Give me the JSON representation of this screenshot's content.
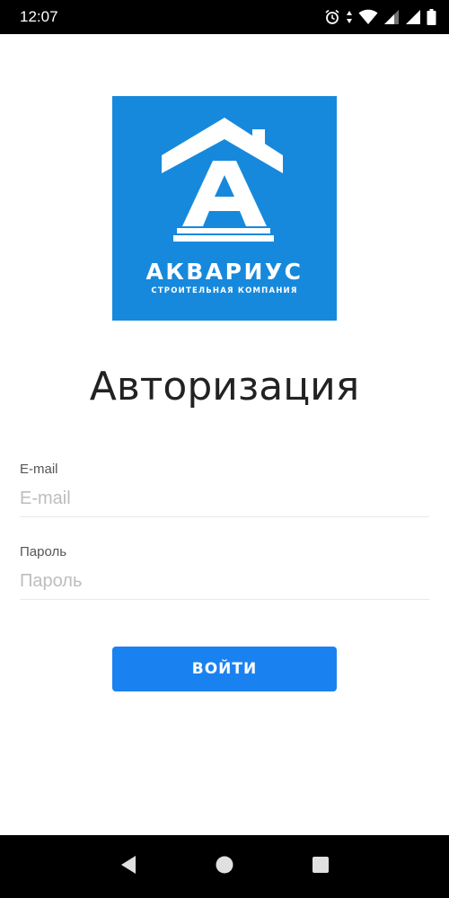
{
  "status_bar": {
    "time": "12:07",
    "icons": [
      "alarm-icon",
      "data-arrows-icon",
      "wifi-icon",
      "signal-icon",
      "signal-icon",
      "battery-icon"
    ]
  },
  "logo": {
    "brand": "АКВАРИУС",
    "tagline": "СТРОИТЕЛЬНАЯ КОМПАНИЯ",
    "background": "#1689dc"
  },
  "page": {
    "title": "Авторизация"
  },
  "form": {
    "email": {
      "label": "E-mail",
      "placeholder": "E-mail",
      "value": ""
    },
    "password": {
      "label": "Пароль",
      "placeholder": "Пароль",
      "value": ""
    },
    "submit_label": "ВОЙТИ"
  },
  "colors": {
    "accent": "#1a82f0",
    "logo_bg": "#1689dc",
    "text": "#222222",
    "placeholder": "#bdbdbd"
  },
  "nav_bar": {
    "buttons": [
      "back-icon",
      "home-icon",
      "recents-icon"
    ]
  }
}
